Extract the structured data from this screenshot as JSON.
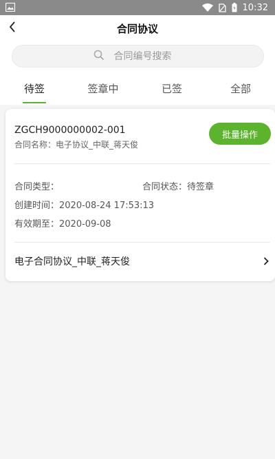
{
  "status_bar": {
    "time": "10:32",
    "icons": [
      "image-icon",
      "wifi-icon",
      "no-sim-icon",
      "battery-icon"
    ]
  },
  "header": {
    "title": "合同协议",
    "back_icon": "chevron-left-icon"
  },
  "search": {
    "placeholder": "合同编号搜索",
    "value": "",
    "icon": "search-icon"
  },
  "tabs": [
    {
      "label": "待签",
      "active": true
    },
    {
      "label": "签章中",
      "active": false
    },
    {
      "label": "已签",
      "active": false
    },
    {
      "label": "全部",
      "active": false
    }
  ],
  "contracts": [
    {
      "number": "ZGCH9000000002-001",
      "name_line": "合同名称：电子协议_中联_蒋天俊",
      "action_label": "批量操作",
      "type_line": "合同类型：",
      "status_line": "合同状态：待签章",
      "created_line": "创建时间：2020-08-24 17:53:13",
      "expire_line": "有效期至：2020-09-08",
      "footer_title": "电子合同协议_中联_蒋天俊",
      "footer_icon": "chevron-right-icon"
    }
  ],
  "colors": {
    "accent": "#5bb42c",
    "status_bar_bg": "#8a8a8a",
    "page_bg": "#f5f5f5"
  }
}
